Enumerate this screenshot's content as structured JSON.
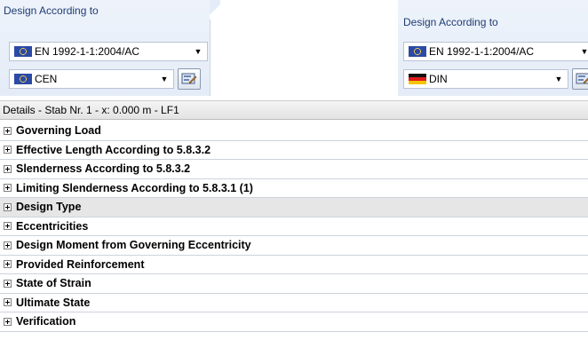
{
  "left_panel": {
    "title": "Design According to",
    "standard_combo": {
      "value": "EN 1992-1-1:2004/AC",
      "flag": "eu-flag-icon"
    },
    "annex_combo": {
      "value": "CEN",
      "flag": "eu-flag-icon"
    },
    "edit_button_icon": "edit-national-annex-icon"
  },
  "right_panel": {
    "title": "Design According to",
    "standard_combo": {
      "value": "EN 1992-1-1:2004/AC",
      "flag": "eu-flag-icon"
    },
    "annex_combo": {
      "value": "DIN",
      "flag": "germany-flag-icon"
    },
    "edit_button_icon": "edit-national-annex-icon"
  },
  "details": {
    "header": "Details  -  Stab Nr. 1  -  x: 0.000 m  -  LF1",
    "items": [
      "Governing Load",
      "Effective Length According to 5.8.3.2",
      "Slenderness According to 5.8.3.2",
      "Limiting Slenderness According to 5.8.3.1 (1)",
      "Design Type",
      "Eccentricities",
      "Design Moment from Governing Eccentricity",
      "Provided Reinforcement",
      "State of Strain",
      "Ultimate State",
      "Verification"
    ],
    "highlighted_index": 4
  },
  "colors": {
    "panel_bg": "#e8eef8",
    "title_text": "#1f3b73",
    "highlight_row": "#e6e6e6"
  }
}
